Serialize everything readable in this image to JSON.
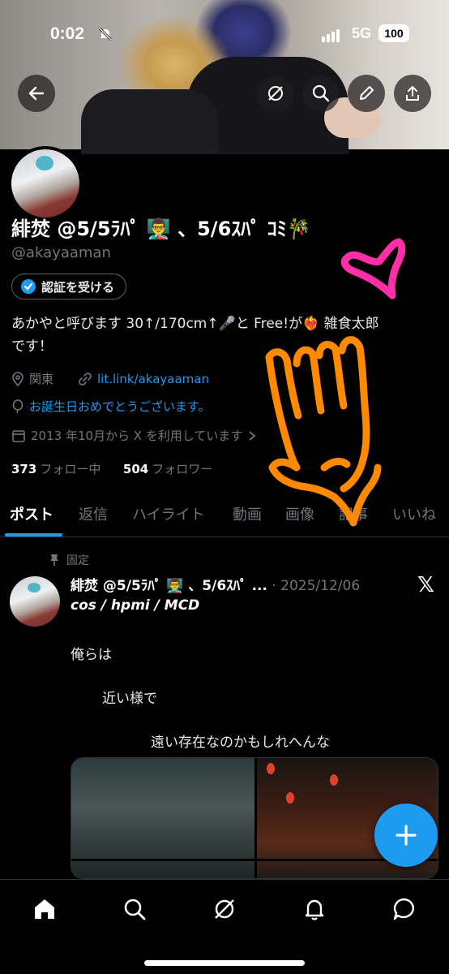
{
  "status_bar": {
    "time": "0:02",
    "network": "5G",
    "battery": "100"
  },
  "profile": {
    "display_name": "緋焚 @5/5ﾗﾊﾟ 👨‍🏫 、5/6ｽﾊﾟ ｺﾐ🎋",
    "handle": "@akayaaman",
    "verify_button": "認証を受ける",
    "bio_line1": "あかやと呼びます 30↑/170cm↑🎤と Free!が❤️‍🔥 雑食太郎",
    "bio_line2": "です！",
    "location": "関東",
    "website": "lit.link/akayaaman",
    "birthday": "お誕生日おめでとうございます。",
    "joined": "2013 年10月から X を利用しています",
    "following_count": "373",
    "following_label": "フォロー中",
    "followers_count": "504",
    "followers_label": "フォロワー"
  },
  "tabs": [
    "ポスト",
    "返信",
    "ハイライト",
    "動画",
    "画像",
    "記事",
    "いいね"
  ],
  "active_tab": "ポスト",
  "pinned_post": {
    "pinned_label": "固定",
    "author": "緋焚 @5/5ﾗﾊﾟ 👨‍🏫 、5/6ｽﾊﾟ ...",
    "date": "· 2025/12/06",
    "subtitle": "cos / hpmi / MCD",
    "line1": "俺らは",
    "line2": "近い様で",
    "line3": "遠い存在なのかもしれへんな"
  },
  "colors": {
    "accent": "#1d9bf0",
    "muted": "#71767b",
    "background": "#000000"
  },
  "icons": [
    "back-arrow-icon",
    "grok-icon",
    "search-icon",
    "edit-icon",
    "share-icon",
    "location-icon",
    "link-icon",
    "balloon-icon",
    "calendar-icon",
    "chevron-right-icon",
    "pin-icon",
    "x-logo-icon",
    "plus-icon",
    "home-icon",
    "notifications-icon",
    "messages-icon"
  ]
}
